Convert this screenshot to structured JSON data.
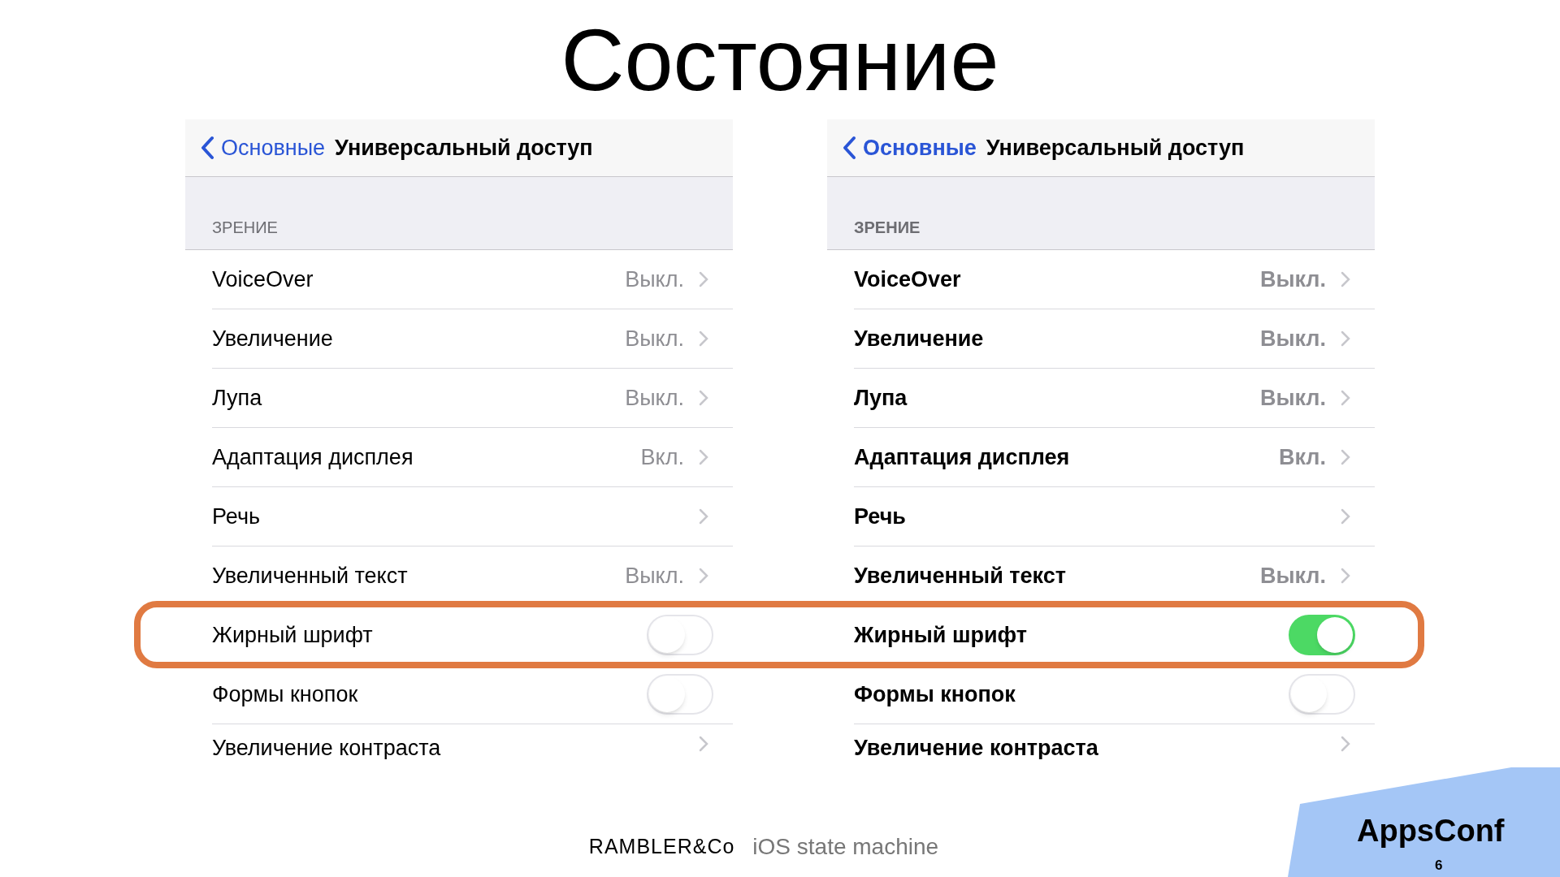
{
  "slide_title": "Состояние",
  "panels": [
    {
      "back_label": "Основные",
      "title": "Универсальный доступ",
      "bold_text": false,
      "section": "ЗРЕНИЕ",
      "rows": [
        {
          "kind": "link",
          "label": "VoiceOver",
          "value": "Выкл."
        },
        {
          "kind": "link",
          "label": "Увеличение",
          "value": "Выкл."
        },
        {
          "kind": "link",
          "label": "Лупа",
          "value": "Выкл."
        },
        {
          "kind": "link",
          "label": "Адаптация дисплея",
          "value": "Вкл."
        },
        {
          "kind": "link",
          "label": "Речь"
        },
        {
          "kind": "link",
          "label": "Увеличенный текст",
          "value": "Выкл."
        },
        {
          "kind": "toggle",
          "label": "Жирный шрифт",
          "on": false
        },
        {
          "kind": "toggle",
          "label": "Формы кнопок",
          "on": false
        },
        {
          "kind": "link",
          "label": "Увеличение контраста"
        }
      ]
    },
    {
      "back_label": "Основные",
      "title": "Универсальный доступ",
      "bold_text": true,
      "section": "ЗРЕНИЕ",
      "rows": [
        {
          "kind": "link",
          "label": "VoiceOver",
          "value": "Выкл."
        },
        {
          "kind": "link",
          "label": "Увеличение",
          "value": "Выкл."
        },
        {
          "kind": "link",
          "label": "Лупа",
          "value": "Выкл."
        },
        {
          "kind": "link",
          "label": "Адаптация дисплея",
          "value": "Вкл."
        },
        {
          "kind": "link",
          "label": "Речь"
        },
        {
          "kind": "link",
          "label": "Увеличенный текст",
          "value": "Выкл."
        },
        {
          "kind": "toggle",
          "label": "Жирный шрифт",
          "on": true
        },
        {
          "kind": "toggle",
          "label": "Формы кнопок",
          "on": false
        },
        {
          "kind": "link",
          "label": "Увеличение контраста"
        }
      ]
    }
  ],
  "footer": {
    "brand": "RAMBLER&Co",
    "caption": "iOS state machine"
  },
  "logo": {
    "name": "AppsConf",
    "page": "6"
  }
}
